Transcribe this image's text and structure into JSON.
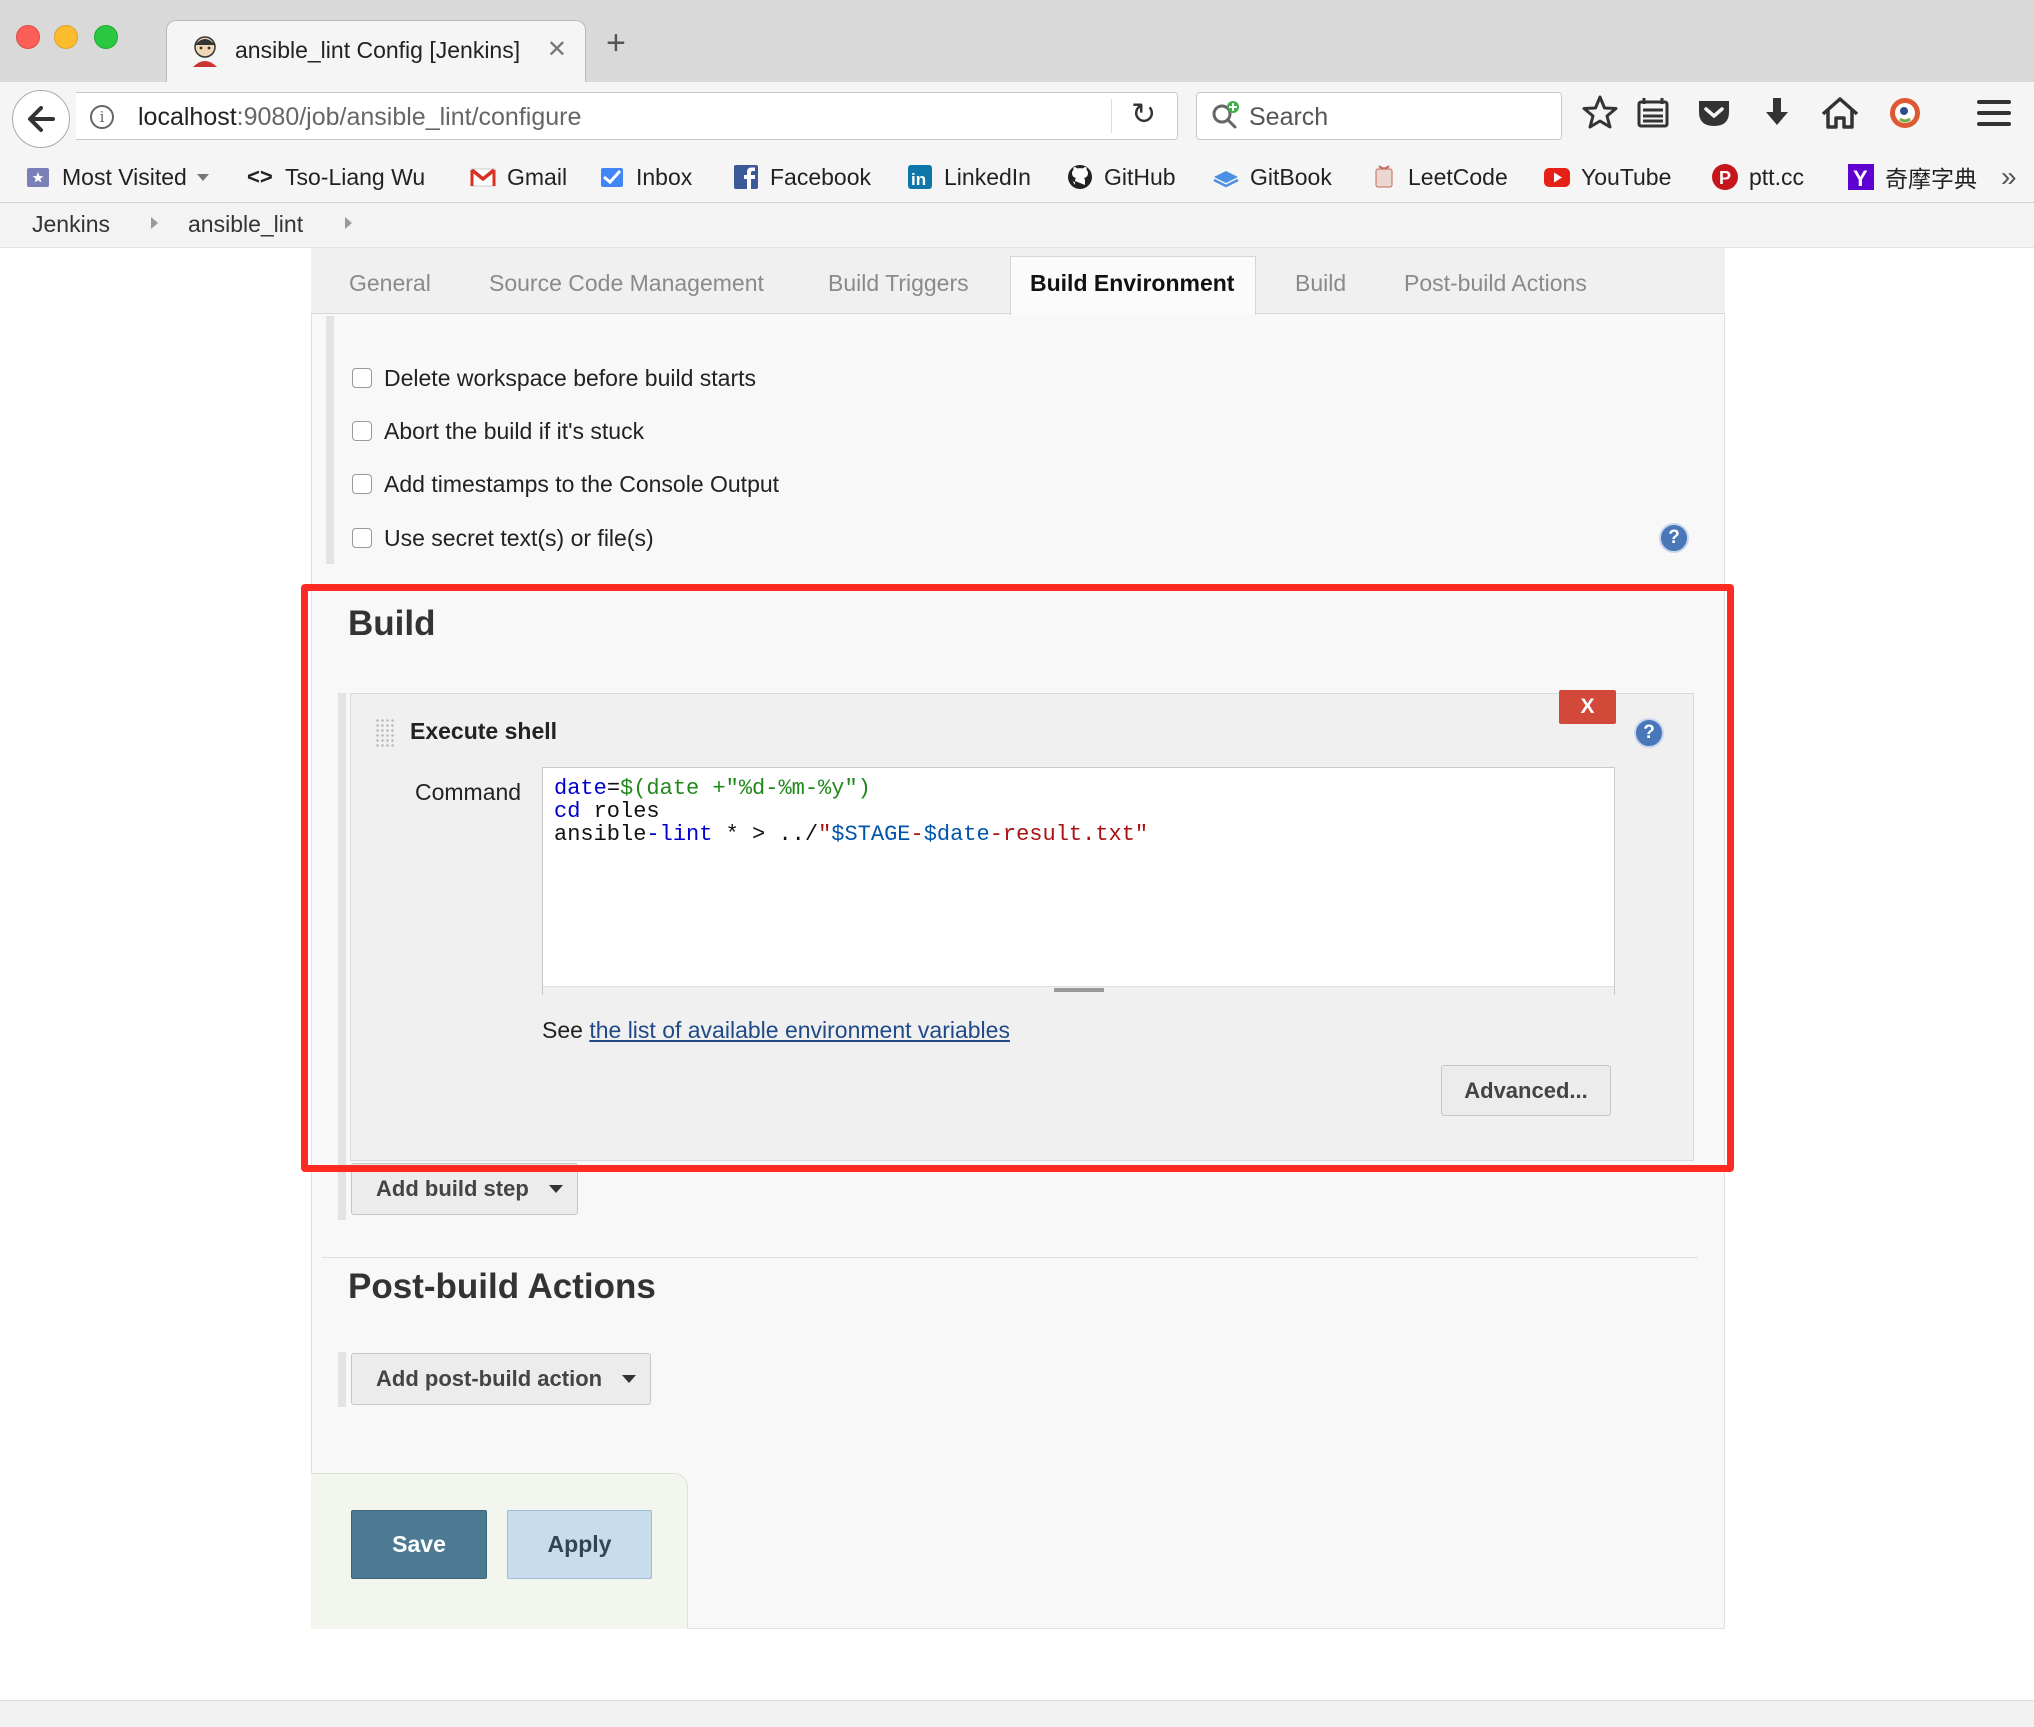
{
  "browser": {
    "tab_title": "ansible_lint Config [Jenkins]",
    "tab_close_glyph": "✕",
    "new_tab_glyph": "+",
    "url_host": "localhost",
    "url_path": ":9080/job/ansible_lint/configure",
    "search_placeholder": "Search",
    "reload_glyph": "↻",
    "info_glyph": "i",
    "toolbar_icons": [
      "bookmark-star-icon",
      "reading-list-icon",
      "pocket-icon",
      "download-icon",
      "home-icon",
      "duckduckgo-icon",
      "hamburger-menu-icon"
    ],
    "bookmarks": [
      {
        "label": "Most Visited",
        "icon": "most-visited-icon"
      },
      {
        "label": "Tso-Liang Wu",
        "icon": "code-brackets-icon"
      },
      {
        "label": "Gmail",
        "icon": "gmail-icon"
      },
      {
        "label": "Inbox",
        "icon": "inbox-icon"
      },
      {
        "label": "Facebook",
        "icon": "facebook-icon"
      },
      {
        "label": "LinkedIn",
        "icon": "linkedin-icon"
      },
      {
        "label": "GitHub",
        "icon": "github-icon"
      },
      {
        "label": "GitBook",
        "icon": "gitbook-icon"
      },
      {
        "label": "LeetCode",
        "icon": "leetcode-icon"
      },
      {
        "label": "YouTube",
        "icon": "youtube-icon"
      },
      {
        "label": "ptt.cc",
        "icon": "ptt-icon"
      },
      {
        "label": "奇摩字典",
        "icon": "yahoo-icon"
      }
    ],
    "overflow_glyph": "»"
  },
  "breadcrumb": {
    "items": [
      "Jenkins",
      "ansible_lint"
    ]
  },
  "config_tabs": [
    "General",
    "Source Code Management",
    "Build Triggers",
    "Build Environment",
    "Build",
    "Post-build Actions"
  ],
  "active_tab": "Build Environment",
  "build_environment": {
    "options": [
      {
        "label": "Delete workspace before build starts",
        "checked": false
      },
      {
        "label": "Abort the build if it's stuck",
        "checked": false
      },
      {
        "label": "Add timestamps to the Console Output",
        "checked": false
      },
      {
        "label": "Use secret text(s) or file(s)",
        "checked": false
      }
    ]
  },
  "help_glyph": "?",
  "build": {
    "heading": "Build",
    "step": {
      "title": "Execute shell",
      "delete_label": "X",
      "command_label": "Command",
      "command_lines": [
        "date=$(date +\"%d-%m-%y\")",
        "cd roles",
        "ansible-lint * > ../\"$STAGE-$date-result.txt\""
      ],
      "see_prefix": "See ",
      "env_link": "the list of available environment variables",
      "advanced_label": "Advanced..."
    },
    "add_step_label": "Add build step"
  },
  "post_build": {
    "heading": "Post-build Actions",
    "add_action_label": "Add post-build action"
  },
  "actions": {
    "save_label": "Save",
    "apply_label": "Apply"
  },
  "colors": {
    "highlight": "#ff2b22",
    "save": "#4c7a93",
    "apply": "#c9dcee",
    "delete": "#d24939"
  }
}
